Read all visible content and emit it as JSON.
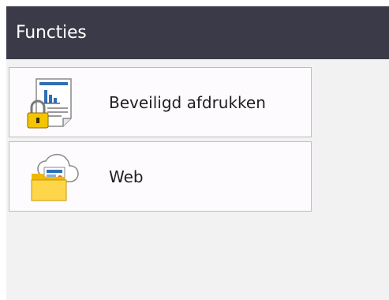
{
  "header": {
    "title": "Functies"
  },
  "items": [
    {
      "label": "Beveiligd afdrukken",
      "icon": "secure-print-icon"
    },
    {
      "label": "Web",
      "icon": "web-folder-icon"
    }
  ],
  "colors": {
    "header_bg": "#3a3a48",
    "screen_bg": "#f2f2f2",
    "item_bg": "#fdfbfd",
    "lock": "#f5c400",
    "folder": "#ffd64a"
  }
}
